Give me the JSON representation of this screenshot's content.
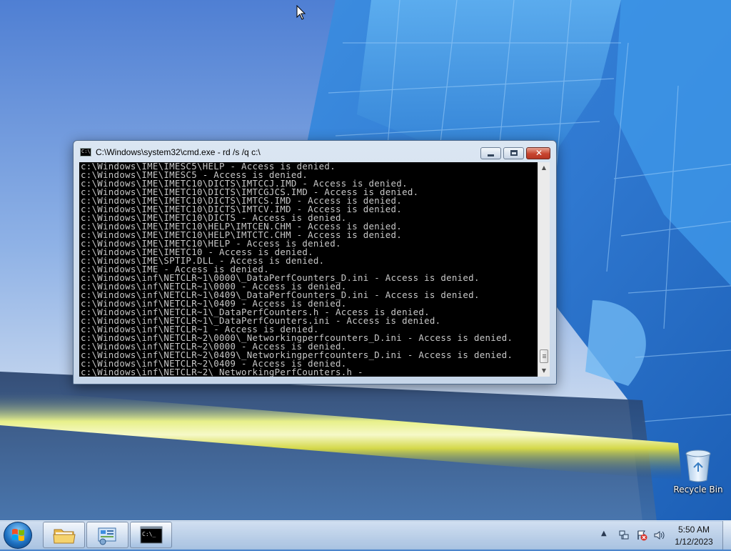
{
  "desktop": {
    "icons": [
      {
        "label": "Recycle Bin",
        "icon": "recycle-bin-icon"
      }
    ]
  },
  "cmd_window": {
    "title": "C:\\Windows\\system32\\cmd.exe - rd  /s /q c:\\",
    "icon_text": "C:\\",
    "buttons": {
      "minimize": "minimize-icon",
      "maximize": "maximize-icon",
      "close": "✕"
    },
    "lines": [
      "c:\\Windows\\IME\\IMESC5\\HELP - Access is denied.",
      "c:\\Windows\\IME\\IMESC5 - Access is denied.",
      "c:\\Windows\\IME\\IMETC10\\DICTS\\IMTCCJ.IMD - Access is denied.",
      "c:\\Windows\\IME\\IMETC10\\DICTS\\IMTCGJCS.IMD - Access is denied.",
      "c:\\Windows\\IME\\IMETC10\\DICTS\\IMTCS.IMD - Access is denied.",
      "c:\\Windows\\IME\\IMETC10\\DICTS\\IMTCV.IMD - Access is denied.",
      "c:\\Windows\\IME\\IMETC10\\DICTS - Access is denied.",
      "c:\\Windows\\IME\\IMETC10\\HELP\\IMTCEN.CHM - Access is denied.",
      "c:\\Windows\\IME\\IMETC10\\HELP\\IMTCTC.CHM - Access is denied.",
      "c:\\Windows\\IME\\IMETC10\\HELP - Access is denied.",
      "c:\\Windows\\IME\\IMETC10 - Access is denied.",
      "c:\\Windows\\IME\\SPTIP.DLL - Access is denied.",
      "c:\\Windows\\IME - Access is denied.",
      "c:\\Windows\\inf\\NETCLR~1\\0000\\_DataPerfCounters_D.ini - Access is denied.",
      "c:\\Windows\\inf\\NETCLR~1\\0000 - Access is denied.",
      "c:\\Windows\\inf\\NETCLR~1\\0409\\_DataPerfCounters_D.ini - Access is denied.",
      "c:\\Windows\\inf\\NETCLR~1\\0409 - Access is denied.",
      "c:\\Windows\\inf\\NETCLR~1\\_DataPerfCounters.h - Access is denied.",
      "c:\\Windows\\inf\\NETCLR~1\\_DataPerfCounters.ini - Access is denied.",
      "c:\\Windows\\inf\\NETCLR~1 - Access is denied.",
      "c:\\Windows\\inf\\NETCLR~2\\0000\\_Networkingperfcounters_D.ini - Access is denied.",
      "c:\\Windows\\inf\\NETCLR~2\\0000 - Access is denied.",
      "c:\\Windows\\inf\\NETCLR~2\\0409\\_Networkingperfcounters_D.ini - Access is denied.",
      "c:\\Windows\\inf\\NETCLR~2\\0409 - Access is denied.",
      "c:\\Windows\\inf\\NETCLR~2\\_NetworkingPerfCounters.h -"
    ],
    "scrollbar": {
      "up": "▲",
      "down": "▼",
      "position": 0.92
    }
  },
  "taskbar": {
    "start_icon": "windows-start-icon",
    "pinned": [
      {
        "name": "windows-explorer",
        "icon": "folder-icon"
      },
      {
        "name": "control-panel",
        "icon": "control-panel-icon"
      },
      {
        "name": "command-prompt",
        "icon": "command-prompt-icon",
        "active": true,
        "icon_text": "C:\\_"
      }
    ],
    "tray": {
      "show_hidden_arrow": "▲",
      "icons": [
        "network-icon",
        "action-center-icon",
        "volume-icon"
      ],
      "time": "5:50 AM",
      "date": "1/12/2023"
    }
  },
  "colors": {
    "console_background": "#000000",
    "console_text": "#c8c8c8",
    "close_button": "#c7452f"
  }
}
